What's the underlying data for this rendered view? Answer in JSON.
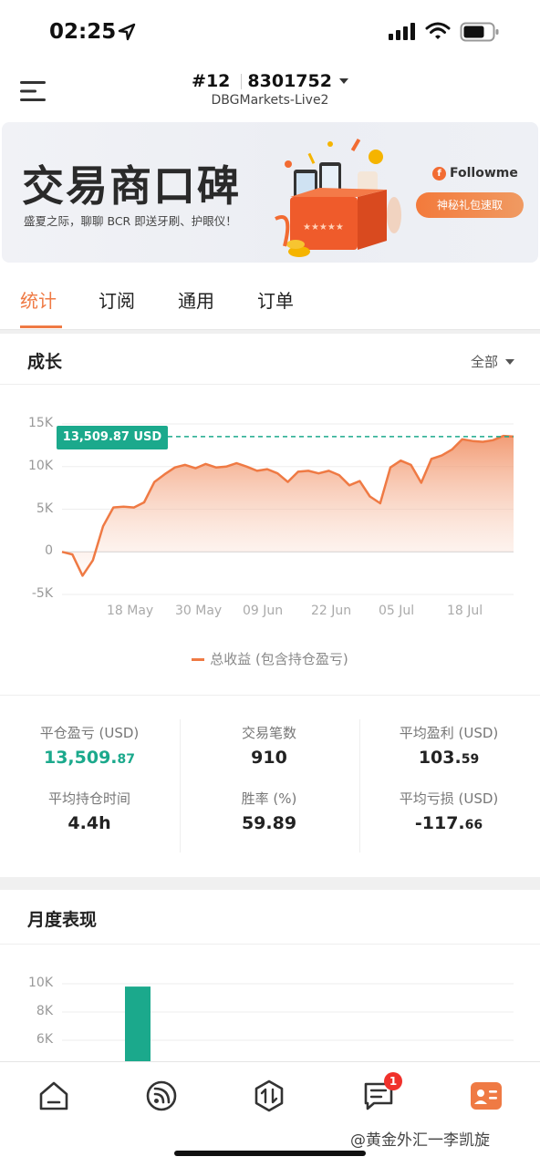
{
  "status_bar": {
    "time": "02:25"
  },
  "header": {
    "account_no": "#12",
    "account_id": "8301752",
    "server": "DBGMarkets-Live2"
  },
  "banner": {
    "title": "交易商口碑",
    "subtitle": "盛夏之际，聊聊 BCR 即送牙刷、护眼仪！",
    "brand": "Followme",
    "cta": "神秘礼包速取"
  },
  "tabs": [
    {
      "label": "统计",
      "active": true
    },
    {
      "label": "订阅",
      "active": false
    },
    {
      "label": "通用",
      "active": false
    },
    {
      "label": "订单",
      "active": false
    }
  ],
  "growth": {
    "title": "成长",
    "filter": "全部",
    "current_value_label": "13,509.87 USD",
    "legend": "总收益 (包含持仓盈亏)"
  },
  "chart_data": [
    {
      "type": "area",
      "ylabel": "",
      "xlabel": "",
      "ylim": [
        -5000,
        15000
      ],
      "y_ticks": [
        "15K",
        "10K",
        "5K",
        "0",
        "-5K"
      ],
      "x_ticks": [
        "18 May",
        "30 May",
        "09 Jun",
        "22 Jun",
        "05 Jul",
        "18 Jul"
      ],
      "series": [
        {
          "name": "总收益 (包含持仓盈亏)",
          "color": "#ef7a44",
          "values": [
            0,
            -300,
            -2800,
            -1000,
            3000,
            5200,
            5300,
            5200,
            5800,
            8200,
            9100,
            9900,
            10200,
            9800,
            10300,
            9900,
            10000,
            10400,
            10000,
            9500,
            9700,
            9200,
            8200,
            9400,
            9500,
            9200,
            9500,
            9000,
            7800,
            8300,
            6500,
            5700,
            9900,
            10700,
            10200,
            8100,
            10900,
            11300,
            12000,
            13200,
            13000,
            12900,
            13100,
            13600,
            13509.87
          ]
        }
      ],
      "reference_line": 13509.87
    },
    {
      "type": "bar",
      "title": "月度表现",
      "y_ticks": [
        "10K",
        "8K",
        "6K"
      ],
      "series": [
        {
          "color": "#1ba98c",
          "values": [
            9800
          ]
        }
      ]
    }
  ],
  "stats": [
    {
      "label": "平仓盈亏 (USD)",
      "int": "13,509.",
      "dec": "87",
      "green": true
    },
    {
      "label": "交易笔数",
      "int": "910",
      "dec": "",
      "green": false
    },
    {
      "label": "平均盈利 (USD)",
      "int": "103.",
      "dec": "59",
      "green": false
    },
    {
      "label": "平均持仓时间",
      "int": "4.4h",
      "dec": "",
      "green": false
    },
    {
      "label": "胜率 (%)",
      "int": "59.89",
      "dec": "",
      "green": false
    },
    {
      "label": "平均亏损 (USD)",
      "int": "-117.",
      "dec": "66",
      "green": false
    }
  ],
  "monthly": {
    "title": "月度表现"
  },
  "bottom_nav": {
    "items": [
      "home-icon",
      "feed-icon",
      "trade-icon",
      "messages-icon",
      "profile-icon"
    ],
    "badge": "1"
  },
  "watermark": "@黄金外汇一李凯旋"
}
